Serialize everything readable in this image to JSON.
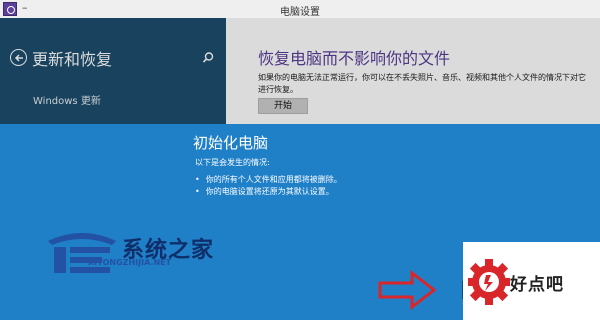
{
  "window": {
    "title": "电脑设置",
    "minimize_glyph": "–"
  },
  "nav": {
    "title": "更新和恢复",
    "items": [
      {
        "label": "Windows 更新"
      }
    ],
    "icons": {
      "back": "back-arrow-icon",
      "search": "search-icon"
    }
  },
  "content": {
    "title": "恢复电脑而不影响你的文件",
    "description": "如果你的电脑无法正常运行，你可以在不丢失照片、音乐、视频和其他个人文件的情况下对它进行恢复。",
    "start_button": "开始"
  },
  "dialog": {
    "title": "初始化电脑",
    "subtitle": "以下是会发生的情况:",
    "bullets": [
      "你的所有个人文件和应用都将被删除。",
      "你的电脑设置将还原为其默认设置。"
    ]
  },
  "watermark": {
    "brand": "系统之家",
    "domain": "XITONGZHIJIA.NET"
  },
  "badge": {
    "text": "好点吧",
    "icon": "gear-logo-icon"
  },
  "colors": {
    "nav_bg": "#1d4d6e",
    "dialog_bg": "#1f7fc7",
    "accent_purple": "#5b3f9a",
    "arrow_red": "#d9262a"
  }
}
